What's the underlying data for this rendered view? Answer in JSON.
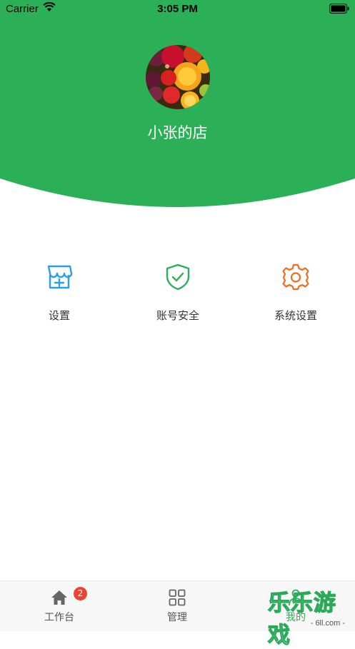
{
  "status_bar": {
    "carrier": "Carrier",
    "time": "3:05 PM"
  },
  "header": {
    "store_name": "小张的店",
    "background_color": "#2bb057"
  },
  "menu": [
    {
      "label": "设置",
      "icon": "store-icon",
      "color": "#2b9ee8"
    },
    {
      "label": "账号安全",
      "icon": "shield-check-icon",
      "color": "#2bb057"
    },
    {
      "label": "系统设置",
      "icon": "gear-icon",
      "color": "#f26b22"
    }
  ],
  "tabbar": {
    "tabs": [
      {
        "label": "工作台",
        "icon": "home-icon"
      },
      {
        "label": "管理",
        "icon": "grid-icon"
      },
      {
        "label": "我的",
        "icon": "person-icon"
      }
    ],
    "workbench_badge": "2"
  },
  "watermark": {
    "text": "乐乐游戏",
    "url": "- 6ll.com -"
  }
}
